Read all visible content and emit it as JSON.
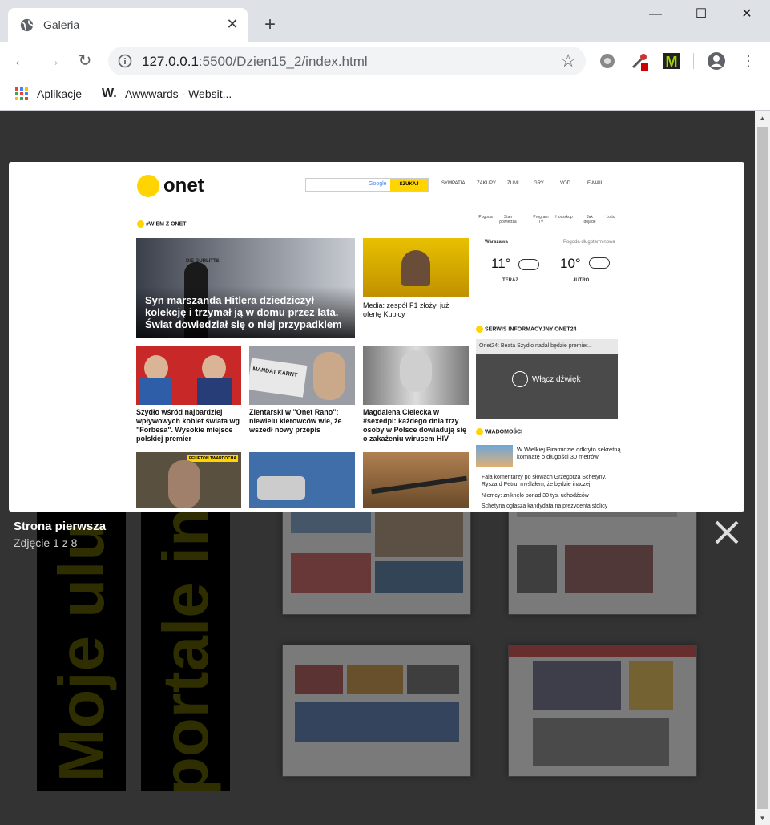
{
  "browser": {
    "tab_title": "Galeria",
    "url_host": "127.0.0.1",
    "url_rest": ":5500/Dzien15_2/index.html",
    "bookmarks": [
      "Aplikacje",
      "Awwwards - Websit..."
    ],
    "bookmark_w_glyph": "W."
  },
  "gallery": {
    "vertical_texts": [
      "Moje ulu",
      "portale in"
    ],
    "caption_title": "Strona pierwsza",
    "caption_count": "Zdjęcie 1 z 8"
  },
  "onet": {
    "logo": "onet",
    "search_button": "SZUKAJ",
    "search_brand": "Google",
    "nav": [
      "SYMPATIA",
      "ZAKUPY",
      "ZUMI",
      "GRY",
      "VOD",
      "E-MAIL"
    ],
    "section_wiem": "#WIEM Z ONET",
    "weather_icons": [
      "Pogoda",
      "Stan powietrza",
      "Program TV",
      "Horoskop",
      "Jak dojadę",
      "Lotto"
    ],
    "weather_city": "Warszawa",
    "weather_long": "Pogoda długoterminowa",
    "temp_now": "11°",
    "temp_now_label": "TERAZ",
    "temp_tomorrow": "10°",
    "temp_tomorrow_label": "JUTRO",
    "lead_caption": "DIE GURLITTS",
    "lead_headline": "Syn marszanda Hitlera dziedziczył kolekcję i trzymał ją w domu przez lata. Świat dowiedział się o niej przypadkiem",
    "art_kubica": "Media: zespół F1 złożył już ofertę Kubicy",
    "art_szydlo": "Szydło wśród najbardziej wpływowych kobiet świata wg \"Forbesa\". Wysokie miejsce polskiej premier",
    "art_zientarski": "Zientarski w \"Onet Rano\": niewielu kierowców wie, że wszedł nowy przepis",
    "art_cielecka": "Magdalena Cielecka w #sexedpl: każdego dnia trzy osoby w Polsce dowiadują się o zakażeniu wirusem HIV",
    "mandat_label": "MANDAT KARNY",
    "felieton": "FELIETON TWARDOCHA",
    "section_serwis": "SERWIS INFORMACYJNY ONET24",
    "video_bar": "Onet24: Beata Szydło nadal będzie premier...",
    "video_sound": "Włącz dźwięk",
    "section_wiadomosci": "WIADOMOŚCI",
    "news_top": "W Wielkiej Piramidzie odkryto sekretną komnatę o długości 30 metrów",
    "news_items": [
      "Fala komentarzy po słowach Grzegorza Schetyny. Ryszard Petru: myślałem, że będzie inaczej",
      "Niemcy: zniknęło ponad 30 tys. uchodźców",
      "Schetyna ogłasza kandydata na prezydenta stolicy"
    ]
  }
}
